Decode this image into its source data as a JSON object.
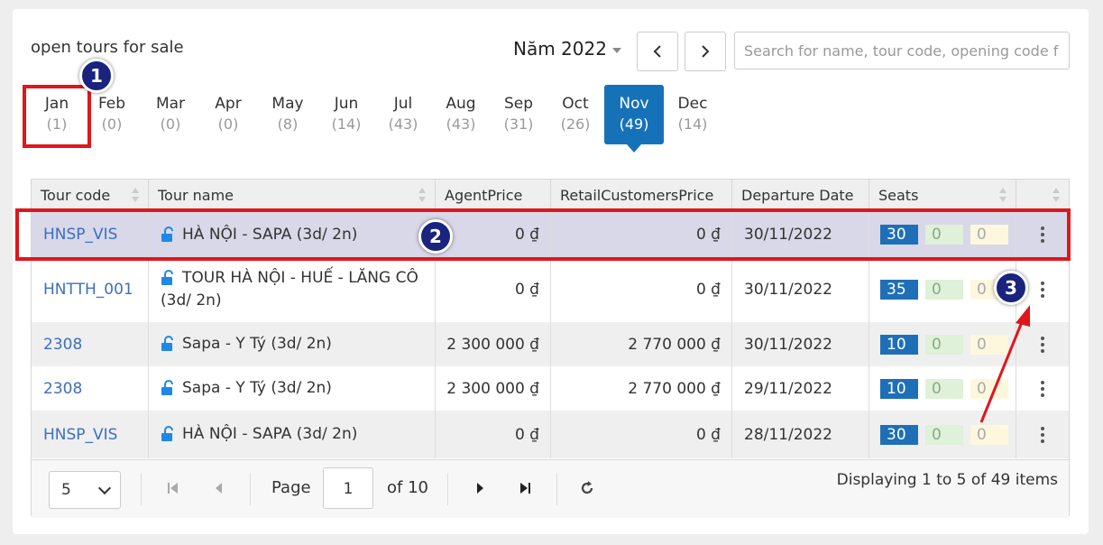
{
  "header": {
    "title": "open tours for sale",
    "year_label": "Năm 2022",
    "search_placeholder": "Search for name, tour code, opening code f"
  },
  "months": [
    {
      "label": "Jan",
      "count": "(1)"
    },
    {
      "label": "Feb",
      "count": "(0)"
    },
    {
      "label": "Mar",
      "count": "(0)"
    },
    {
      "label": "Apr",
      "count": "(0)"
    },
    {
      "label": "May",
      "count": "(8)"
    },
    {
      "label": "Jun",
      "count": "(14)"
    },
    {
      "label": "Jul",
      "count": "(43)"
    },
    {
      "label": "Aug",
      "count": "(43)"
    },
    {
      "label": "Sep",
      "count": "(31)"
    },
    {
      "label": "Oct",
      "count": "(26)"
    },
    {
      "label": "Nov",
      "count": "(49)"
    },
    {
      "label": "Dec",
      "count": "(14)"
    }
  ],
  "active_month": "Nov",
  "table": {
    "columns": [
      "Tour code",
      "Tour name",
      "AgentPrice",
      "RetailCustomersPrice",
      "Departure Date",
      "Seats"
    ],
    "rows": [
      {
        "code": "HNSP_VIS",
        "name": "HÀ NỘI - SAPA (3d/ 2n)",
        "agent_price": "0 ₫",
        "retail_price": "0 ₫",
        "date": "30/11/2022",
        "seats": [
          "30",
          "0",
          "0"
        ]
      },
      {
        "code": "HNTTH_001",
        "name": "TOUR HÀ NỘI - HUẾ - LĂNG CÔ (3d/ 2n)",
        "agent_price": "0 ₫",
        "retail_price": "0 ₫",
        "date": "30/11/2022",
        "seats": [
          "35",
          "0",
          "0"
        ]
      },
      {
        "code": "2308",
        "name": "Sapa - Y Tý (3d/ 2n)",
        "agent_price": "2 300 000 ₫",
        "retail_price": "2 770 000 ₫",
        "date": "30/11/2022",
        "seats": [
          "10",
          "0",
          "0"
        ]
      },
      {
        "code": "2308",
        "name": "Sapa - Y Tý (3d/ 2n)",
        "agent_price": "2 300 000 ₫",
        "retail_price": "2 770 000 ₫",
        "date": "29/11/2022",
        "seats": [
          "10",
          "0",
          "0"
        ]
      },
      {
        "code": "HNSP_VIS",
        "name": "HÀ NỘI - SAPA (3d/ 2n)",
        "agent_price": "0 ₫",
        "retail_price": "0 ₫",
        "date": "28/11/2022",
        "seats": [
          "30",
          "0",
          "0"
        ]
      }
    ]
  },
  "pager": {
    "page_size": "5",
    "page_label": "Page",
    "page_value": "1",
    "of_label": "of 10",
    "info": "Displaying 1 to 5 of 49 items"
  },
  "annotations": [
    "1",
    "2",
    "3"
  ],
  "colors": {
    "accent": "#1672b8",
    "highlight": "#e0161b",
    "badge": "#1a237e",
    "link": "#3a6fc4"
  }
}
